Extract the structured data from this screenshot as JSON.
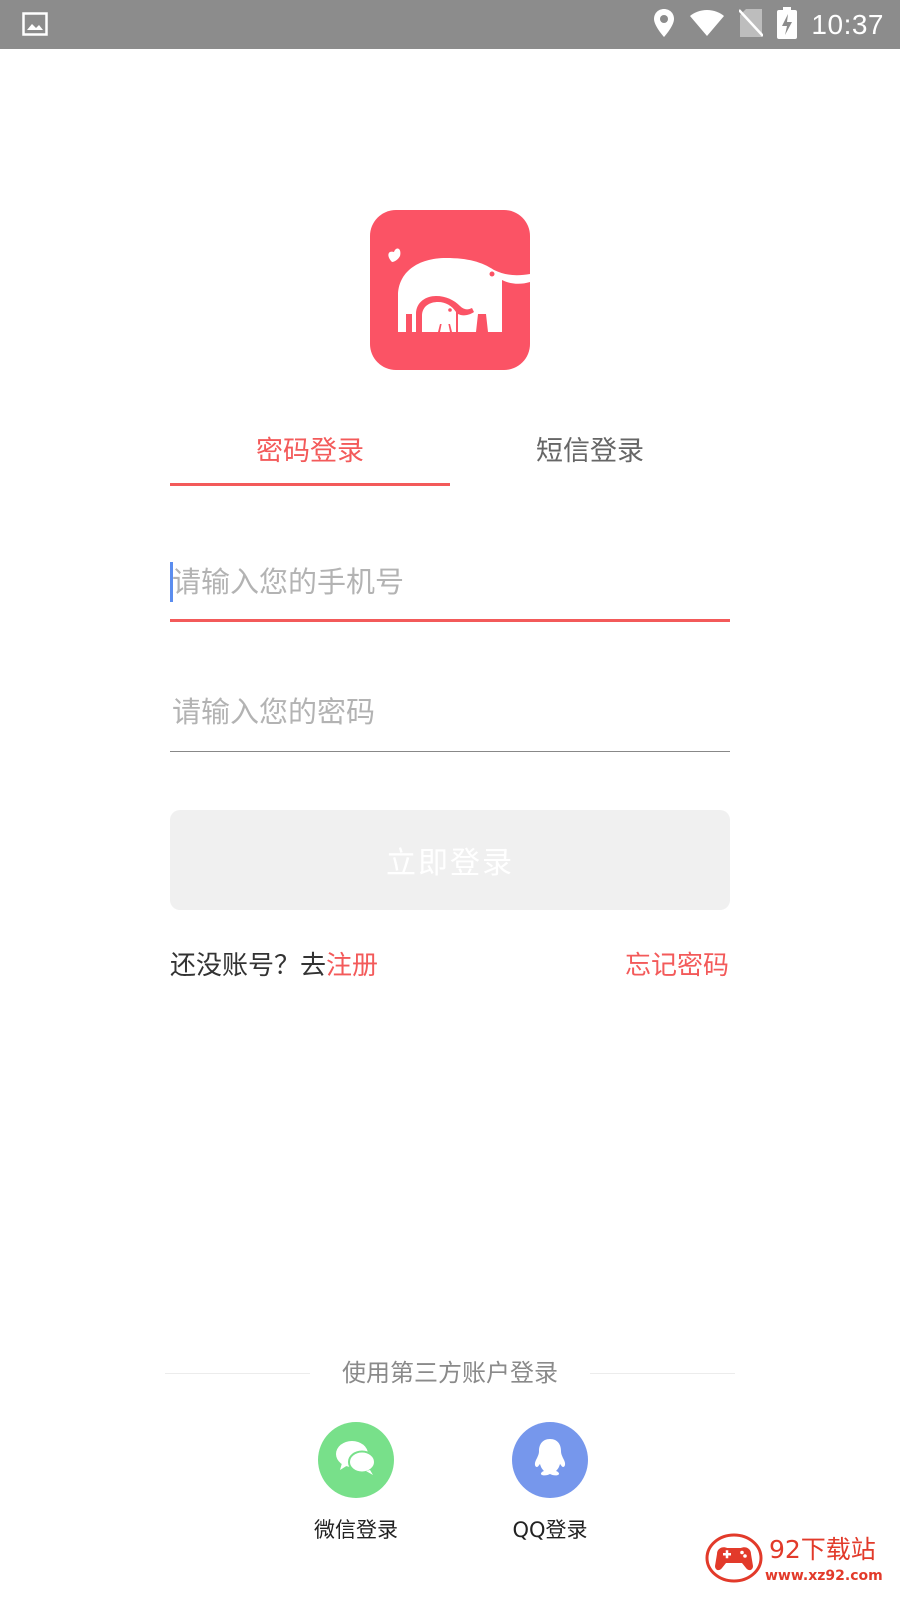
{
  "status_bar": {
    "time": "10:37",
    "icons": [
      "gallery-icon",
      "location-icon",
      "wifi-icon",
      "no-sim-icon",
      "battery-charging-icon"
    ]
  },
  "app": {
    "logo_icon": "elephant-logo-icon",
    "brand_color": "#fb5365",
    "accent_color": "#f35a5a"
  },
  "tabs": [
    {
      "label": "密码登录",
      "active": true
    },
    {
      "label": "短信登录",
      "active": false
    }
  ],
  "form": {
    "phone_placeholder": "请输入您的手机号",
    "phone_value": "",
    "password_placeholder": "请输入您的密码",
    "password_value": "",
    "submit_label": "立即登录"
  },
  "links": {
    "register_prefix": "还没账号？去",
    "register_label": "注册",
    "forget_label": "忘记密码"
  },
  "third_party": {
    "title": "使用第三方账户登录",
    "wechat_label": "微信登录",
    "qq_label": "QQ登录"
  },
  "watermark": {
    "name": "92下载站",
    "url": "www.xz92.com"
  }
}
